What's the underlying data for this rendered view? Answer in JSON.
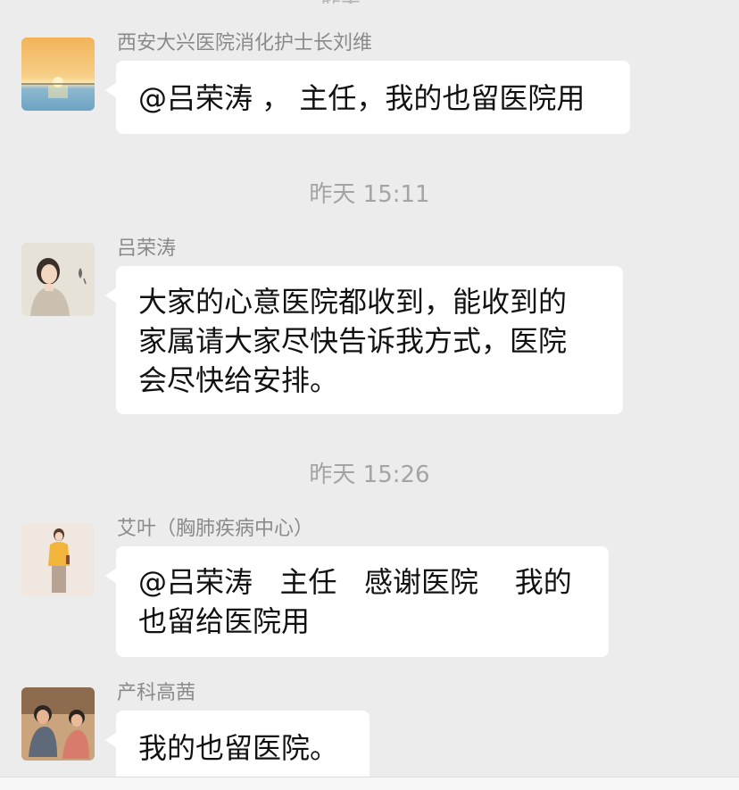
{
  "top_partial_text": "昨天",
  "messages": [
    {
      "sender": "西安大兴医院消化护士长刘维",
      "text": "@吕荣涛 ， 主任，我的也留医院用",
      "avatar_icon": "sunset-avatar-icon"
    },
    {
      "sender": "吕荣涛",
      "text": "大家的心意医院都收到，能收到的\n家属请大家尽快告诉我方式，医院\n会尽快给安排。",
      "avatar_icon": "woman-portrait-avatar-icon"
    },
    {
      "sender": "艾叶（胸肺疾病中心）",
      "text": "@吕荣涛   主任   感谢医院    我的\n也留给医院用",
      "avatar_icon": "woman-standing-avatar-icon"
    },
    {
      "sender": "产科高茜",
      "text": "我的也留医院。",
      "avatar_icon": "children-photo-avatar-icon"
    }
  ],
  "timestamps": [
    "昨天 15:11",
    "昨天 15:26"
  ],
  "colors": {
    "background": "#ececec",
    "bubble": "#ffffff",
    "sender_name": "#8a8a8a",
    "timestamp": "#a4a4a4",
    "message_text": "#111111"
  }
}
